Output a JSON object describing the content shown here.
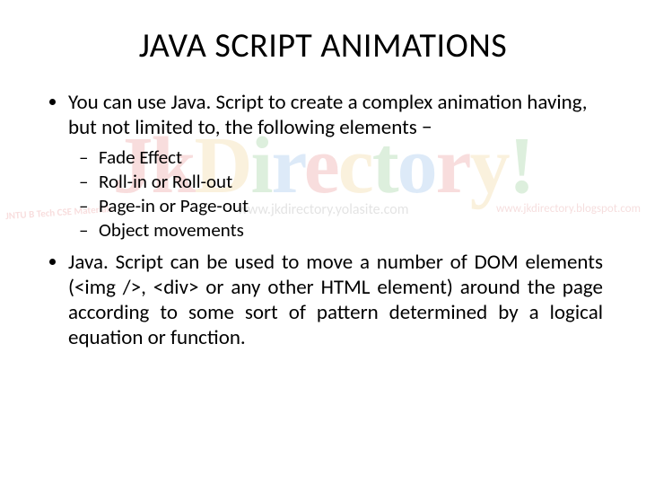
{
  "title": "JAVA SCRIPT ANIMATIONS",
  "bullets": {
    "b1": "You can use Java. Script to create a complex animation having, but not limited to, the following elements −",
    "sub": {
      "s1": "Fade Effect",
      "s2": "Roll-in or Roll-out",
      "s3": "Page-in or Page-out",
      "s4": "Object movements"
    },
    "b2": "Java. Script can be used to move a number of DOM elements (<img />, <div> or any other HTML element) around the page according to some sort of pattern determined by a logical equation or function."
  },
  "watermark": {
    "brand_prefix": "Jk",
    "brand_rest": "Directory!",
    "left_note": "JNTU B Tech CSE Materials",
    "sub_url": "www.jkdirectory.yolasite.com",
    "right_url": "www.jkdirectory.blogspot.com"
  }
}
